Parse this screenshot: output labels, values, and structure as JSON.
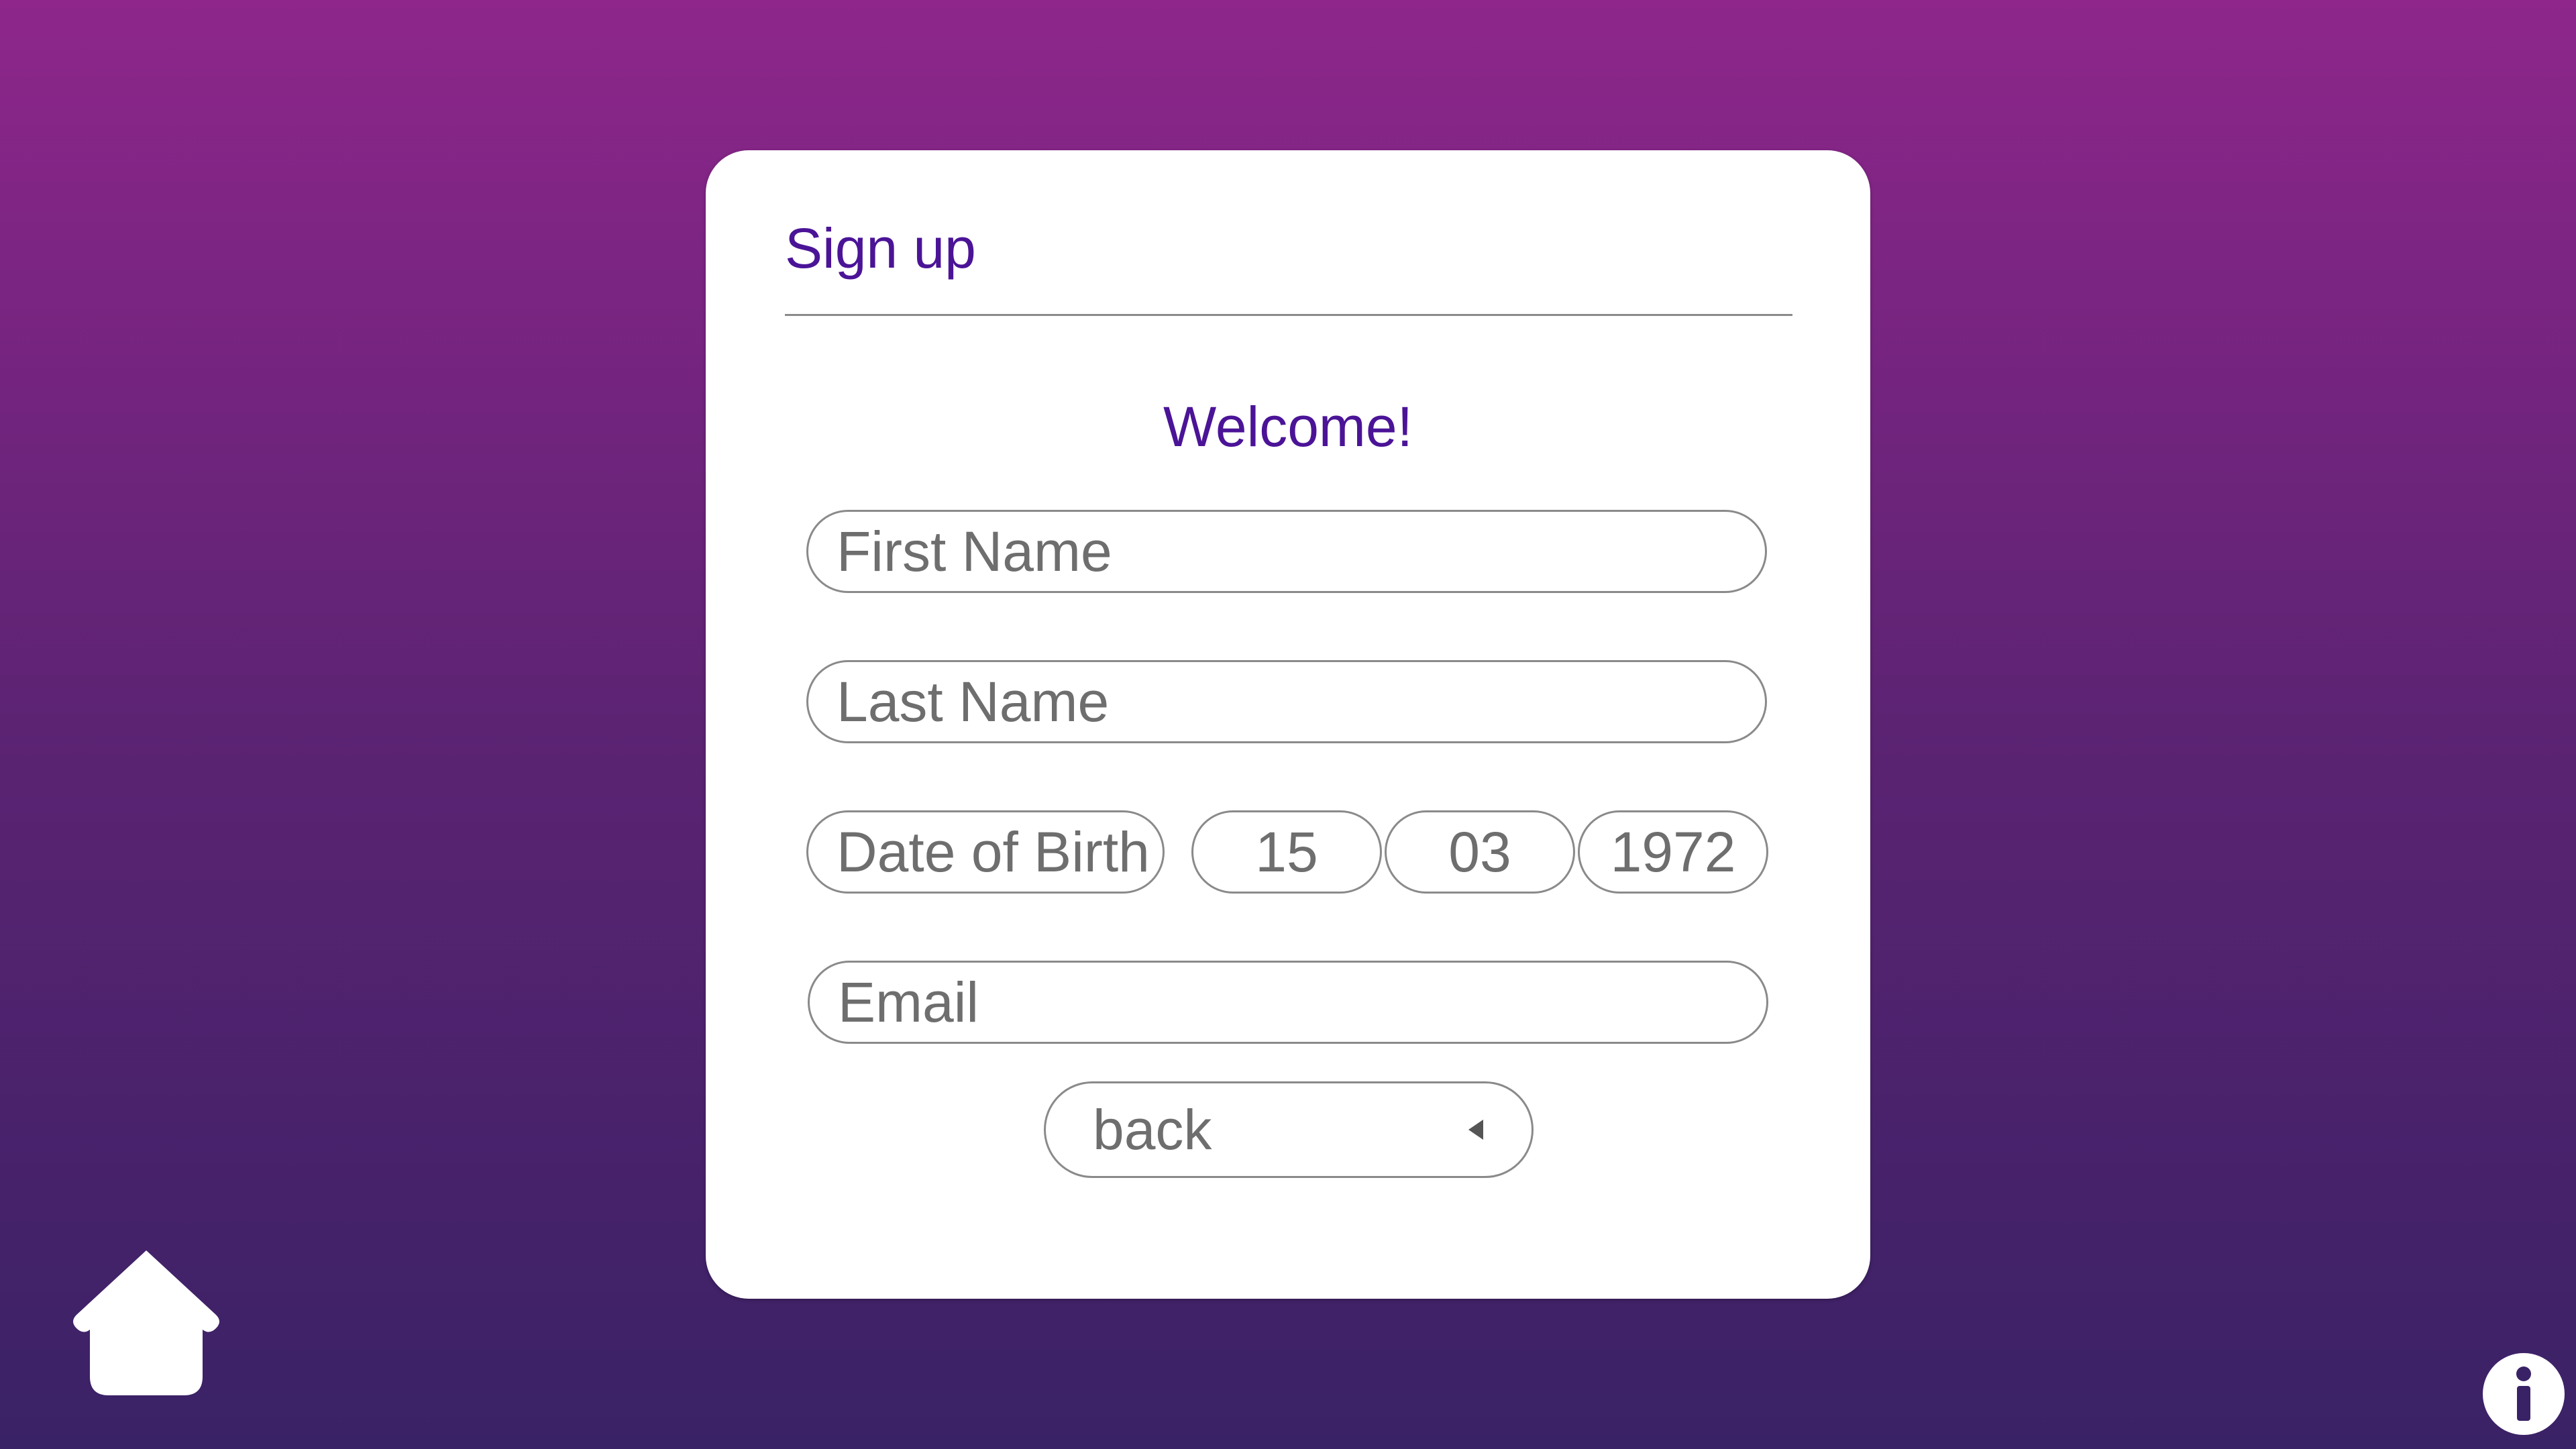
{
  "signup": {
    "title": "Sign up",
    "welcome": "Welcome!",
    "first_name_placeholder": "First Name",
    "last_name_placeholder": "Last Name",
    "dob_label": "Date of Birth",
    "dob_day": "15",
    "dob_month": "03",
    "dob_year": "1972",
    "email_placeholder": "Email",
    "back_label": "back"
  },
  "icons": {
    "home": "home-icon",
    "info": "info-icon",
    "back_arrow": "triangle-left-icon"
  },
  "colors": {
    "background_top": "#8e268b",
    "background_bottom": "#3a2266",
    "accent_text": "#4b1497",
    "field_text": "#6e6e6e",
    "field_border": "#8a8a8a",
    "card": "#ffffff"
  }
}
